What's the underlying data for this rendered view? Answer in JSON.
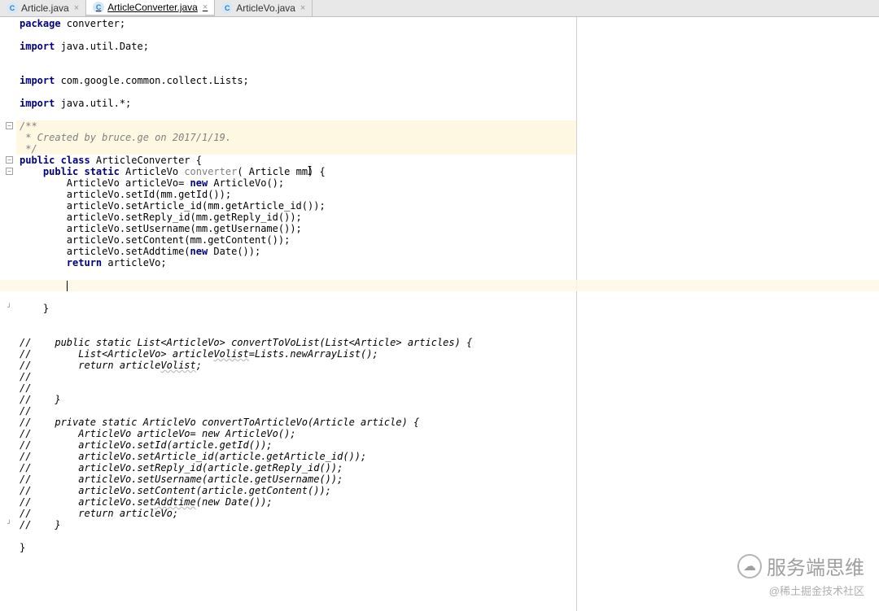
{
  "tabs": [
    {
      "label": "Article.java",
      "active": false
    },
    {
      "label": "ArticleConverter.java",
      "active": true
    },
    {
      "label": "ArticleVo.java",
      "active": false
    }
  ],
  "code": {
    "l0": "package converter;",
    "l2": "import java.util.Date;",
    "l5": "import com.google.common.collect.Lists;",
    "l7": "import java.util.*;",
    "d0": "/**",
    "d1": " * Created by bruce.ge on 2017/1/19.",
    "d2": " */",
    "c0": "public class ArticleConverter {",
    "c1": "    public static ArticleVo converter( Article mm) {",
    "c2": "        ArticleVo articleVo= new ArticleVo();",
    "c3": "        articleVo.setId(mm.getId());",
    "c4": "        articleVo.setArticle_id(mm.getArticle_id());",
    "c5": "        articleVo.setReply_id(mm.getReply_id());",
    "c6": "        articleVo.setUsername(mm.getUsername());",
    "c7": "        articleVo.setContent(mm.getContent());",
    "c8": "        articleVo.setAddtime(new Date());",
    "c9": "        return articleVo;",
    "c11": "    }",
    "m0": "//    public static List<ArticleVo> convertToVoList(List<Article> articles) {",
    "m1": "//        List<ArticleVo> articleVolist=Lists.newArrayList();",
    "m2": "//        return articleVolist;",
    "m3": "//",
    "m4": "//",
    "m5": "//    }",
    "m6": "//",
    "m7": "//    private static ArticleVo convertToArticleVo(Article article) {",
    "m8": "//        ArticleVo articleVo= new ArticleVo();",
    "m9": "//        articleVo.setId(article.getId());",
    "m10": "//        articleVo.setArticle_id(article.getArticle_id());",
    "m11": "//        articleVo.setReply_id(article.getReply_id());",
    "m12": "//        articleVo.setUsername(article.getUsername());",
    "m13": "//        articleVo.setContent(article.getContent());",
    "m14": "//        articleVo.setAddtime(new Date());",
    "m15": "//        return articleVo;",
    "m16": "//    }",
    "end": "}"
  },
  "watermark": {
    "line1": "服务端思维",
    "line2": "@稀土掘金技术社区"
  }
}
